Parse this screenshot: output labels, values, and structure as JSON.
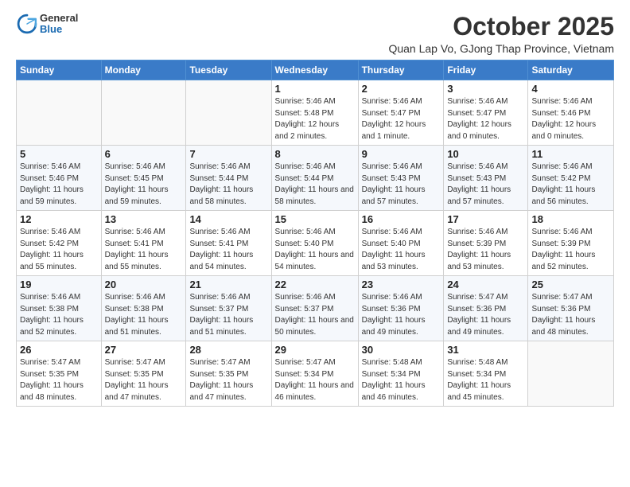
{
  "logo": {
    "general": "General",
    "blue": "Blue"
  },
  "title": "October 2025",
  "subtitle": "Quan Lap Vo, GJong Thap Province, Vietnam",
  "days_of_week": [
    "Sunday",
    "Monday",
    "Tuesday",
    "Wednesday",
    "Thursday",
    "Friday",
    "Saturday"
  ],
  "weeks": [
    [
      {
        "day": "",
        "info": ""
      },
      {
        "day": "",
        "info": ""
      },
      {
        "day": "",
        "info": ""
      },
      {
        "day": "1",
        "info": "Sunrise: 5:46 AM\nSunset: 5:48 PM\nDaylight: 12 hours\nand 2 minutes."
      },
      {
        "day": "2",
        "info": "Sunrise: 5:46 AM\nSunset: 5:47 PM\nDaylight: 12 hours\nand 1 minute."
      },
      {
        "day": "3",
        "info": "Sunrise: 5:46 AM\nSunset: 5:47 PM\nDaylight: 12 hours\nand 0 minutes."
      },
      {
        "day": "4",
        "info": "Sunrise: 5:46 AM\nSunset: 5:46 PM\nDaylight: 12 hours\nand 0 minutes."
      }
    ],
    [
      {
        "day": "5",
        "info": "Sunrise: 5:46 AM\nSunset: 5:46 PM\nDaylight: 11 hours\nand 59 minutes."
      },
      {
        "day": "6",
        "info": "Sunrise: 5:46 AM\nSunset: 5:45 PM\nDaylight: 11 hours\nand 59 minutes."
      },
      {
        "day": "7",
        "info": "Sunrise: 5:46 AM\nSunset: 5:44 PM\nDaylight: 11 hours\nand 58 minutes."
      },
      {
        "day": "8",
        "info": "Sunrise: 5:46 AM\nSunset: 5:44 PM\nDaylight: 11 hours\nand 58 minutes."
      },
      {
        "day": "9",
        "info": "Sunrise: 5:46 AM\nSunset: 5:43 PM\nDaylight: 11 hours\nand 57 minutes."
      },
      {
        "day": "10",
        "info": "Sunrise: 5:46 AM\nSunset: 5:43 PM\nDaylight: 11 hours\nand 57 minutes."
      },
      {
        "day": "11",
        "info": "Sunrise: 5:46 AM\nSunset: 5:42 PM\nDaylight: 11 hours\nand 56 minutes."
      }
    ],
    [
      {
        "day": "12",
        "info": "Sunrise: 5:46 AM\nSunset: 5:42 PM\nDaylight: 11 hours\nand 55 minutes."
      },
      {
        "day": "13",
        "info": "Sunrise: 5:46 AM\nSunset: 5:41 PM\nDaylight: 11 hours\nand 55 minutes."
      },
      {
        "day": "14",
        "info": "Sunrise: 5:46 AM\nSunset: 5:41 PM\nDaylight: 11 hours\nand 54 minutes."
      },
      {
        "day": "15",
        "info": "Sunrise: 5:46 AM\nSunset: 5:40 PM\nDaylight: 11 hours\nand 54 minutes."
      },
      {
        "day": "16",
        "info": "Sunrise: 5:46 AM\nSunset: 5:40 PM\nDaylight: 11 hours\nand 53 minutes."
      },
      {
        "day": "17",
        "info": "Sunrise: 5:46 AM\nSunset: 5:39 PM\nDaylight: 11 hours\nand 53 minutes."
      },
      {
        "day": "18",
        "info": "Sunrise: 5:46 AM\nSunset: 5:39 PM\nDaylight: 11 hours\nand 52 minutes."
      }
    ],
    [
      {
        "day": "19",
        "info": "Sunrise: 5:46 AM\nSunset: 5:38 PM\nDaylight: 11 hours\nand 52 minutes."
      },
      {
        "day": "20",
        "info": "Sunrise: 5:46 AM\nSunset: 5:38 PM\nDaylight: 11 hours\nand 51 minutes."
      },
      {
        "day": "21",
        "info": "Sunrise: 5:46 AM\nSunset: 5:37 PM\nDaylight: 11 hours\nand 51 minutes."
      },
      {
        "day": "22",
        "info": "Sunrise: 5:46 AM\nSunset: 5:37 PM\nDaylight: 11 hours\nand 50 minutes."
      },
      {
        "day": "23",
        "info": "Sunrise: 5:46 AM\nSunset: 5:36 PM\nDaylight: 11 hours\nand 49 minutes."
      },
      {
        "day": "24",
        "info": "Sunrise: 5:47 AM\nSunset: 5:36 PM\nDaylight: 11 hours\nand 49 minutes."
      },
      {
        "day": "25",
        "info": "Sunrise: 5:47 AM\nSunset: 5:36 PM\nDaylight: 11 hours\nand 48 minutes."
      }
    ],
    [
      {
        "day": "26",
        "info": "Sunrise: 5:47 AM\nSunset: 5:35 PM\nDaylight: 11 hours\nand 48 minutes."
      },
      {
        "day": "27",
        "info": "Sunrise: 5:47 AM\nSunset: 5:35 PM\nDaylight: 11 hours\nand 47 minutes."
      },
      {
        "day": "28",
        "info": "Sunrise: 5:47 AM\nSunset: 5:35 PM\nDaylight: 11 hours\nand 47 minutes."
      },
      {
        "day": "29",
        "info": "Sunrise: 5:47 AM\nSunset: 5:34 PM\nDaylight: 11 hours\nand 46 minutes."
      },
      {
        "day": "30",
        "info": "Sunrise: 5:48 AM\nSunset: 5:34 PM\nDaylight: 11 hours\nand 46 minutes."
      },
      {
        "day": "31",
        "info": "Sunrise: 5:48 AM\nSunset: 5:34 PM\nDaylight: 11 hours\nand 45 minutes."
      },
      {
        "day": "",
        "info": ""
      }
    ]
  ]
}
